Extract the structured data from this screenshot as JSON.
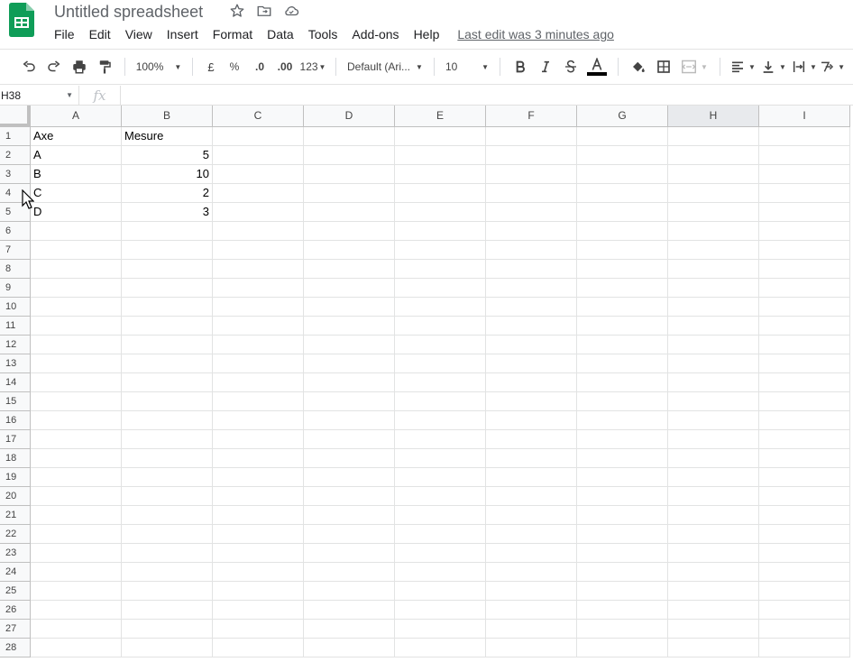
{
  "document": {
    "title": "Untitled spreadsheet"
  },
  "menu": {
    "items": [
      "File",
      "Edit",
      "View",
      "Insert",
      "Format",
      "Data",
      "Tools",
      "Add-ons",
      "Help"
    ],
    "last_edit": "Last edit was 3 minutes ago"
  },
  "toolbar": {
    "zoom": "100%",
    "currency": "£",
    "percent": "%",
    "decrease_decimal": ".0",
    "increase_decimal": ".00",
    "more_formats": "123",
    "font": "Default (Ari...",
    "font_size": "10"
  },
  "formula_bar": {
    "cell_ref": "H38",
    "fx": "fx",
    "value": ""
  },
  "grid": {
    "columns": [
      "A",
      "B",
      "C",
      "D",
      "E",
      "F",
      "G",
      "H",
      "I"
    ],
    "selected_column": "H",
    "rows": [
      "1",
      "2",
      "3",
      "4",
      "5",
      "6",
      "7",
      "8",
      "9",
      "10",
      "11",
      "12",
      "13",
      "14",
      "15",
      "16",
      "17",
      "18",
      "19",
      "20",
      "21",
      "22",
      "23",
      "24",
      "25",
      "26",
      "27",
      "28"
    ],
    "cells": [
      {
        "row": 1,
        "col": "A",
        "value": "Axe",
        "type": "text"
      },
      {
        "row": 1,
        "col": "B",
        "value": "Mesure",
        "type": "text"
      },
      {
        "row": 2,
        "col": "A",
        "value": "A",
        "type": "text"
      },
      {
        "row": 2,
        "col": "B",
        "value": "5",
        "type": "number"
      },
      {
        "row": 3,
        "col": "A",
        "value": "B",
        "type": "text"
      },
      {
        "row": 3,
        "col": "B",
        "value": "10",
        "type": "number"
      },
      {
        "row": 4,
        "col": "A",
        "value": "C",
        "type": "text"
      },
      {
        "row": 4,
        "col": "B",
        "value": "2",
        "type": "number"
      },
      {
        "row": 5,
        "col": "A",
        "value": "D",
        "type": "text"
      },
      {
        "row": 5,
        "col": "B",
        "value": "3",
        "type": "number"
      }
    ]
  },
  "colors": {
    "sheets_green": "#0f9d58",
    "text_color_bar": "#000000"
  }
}
